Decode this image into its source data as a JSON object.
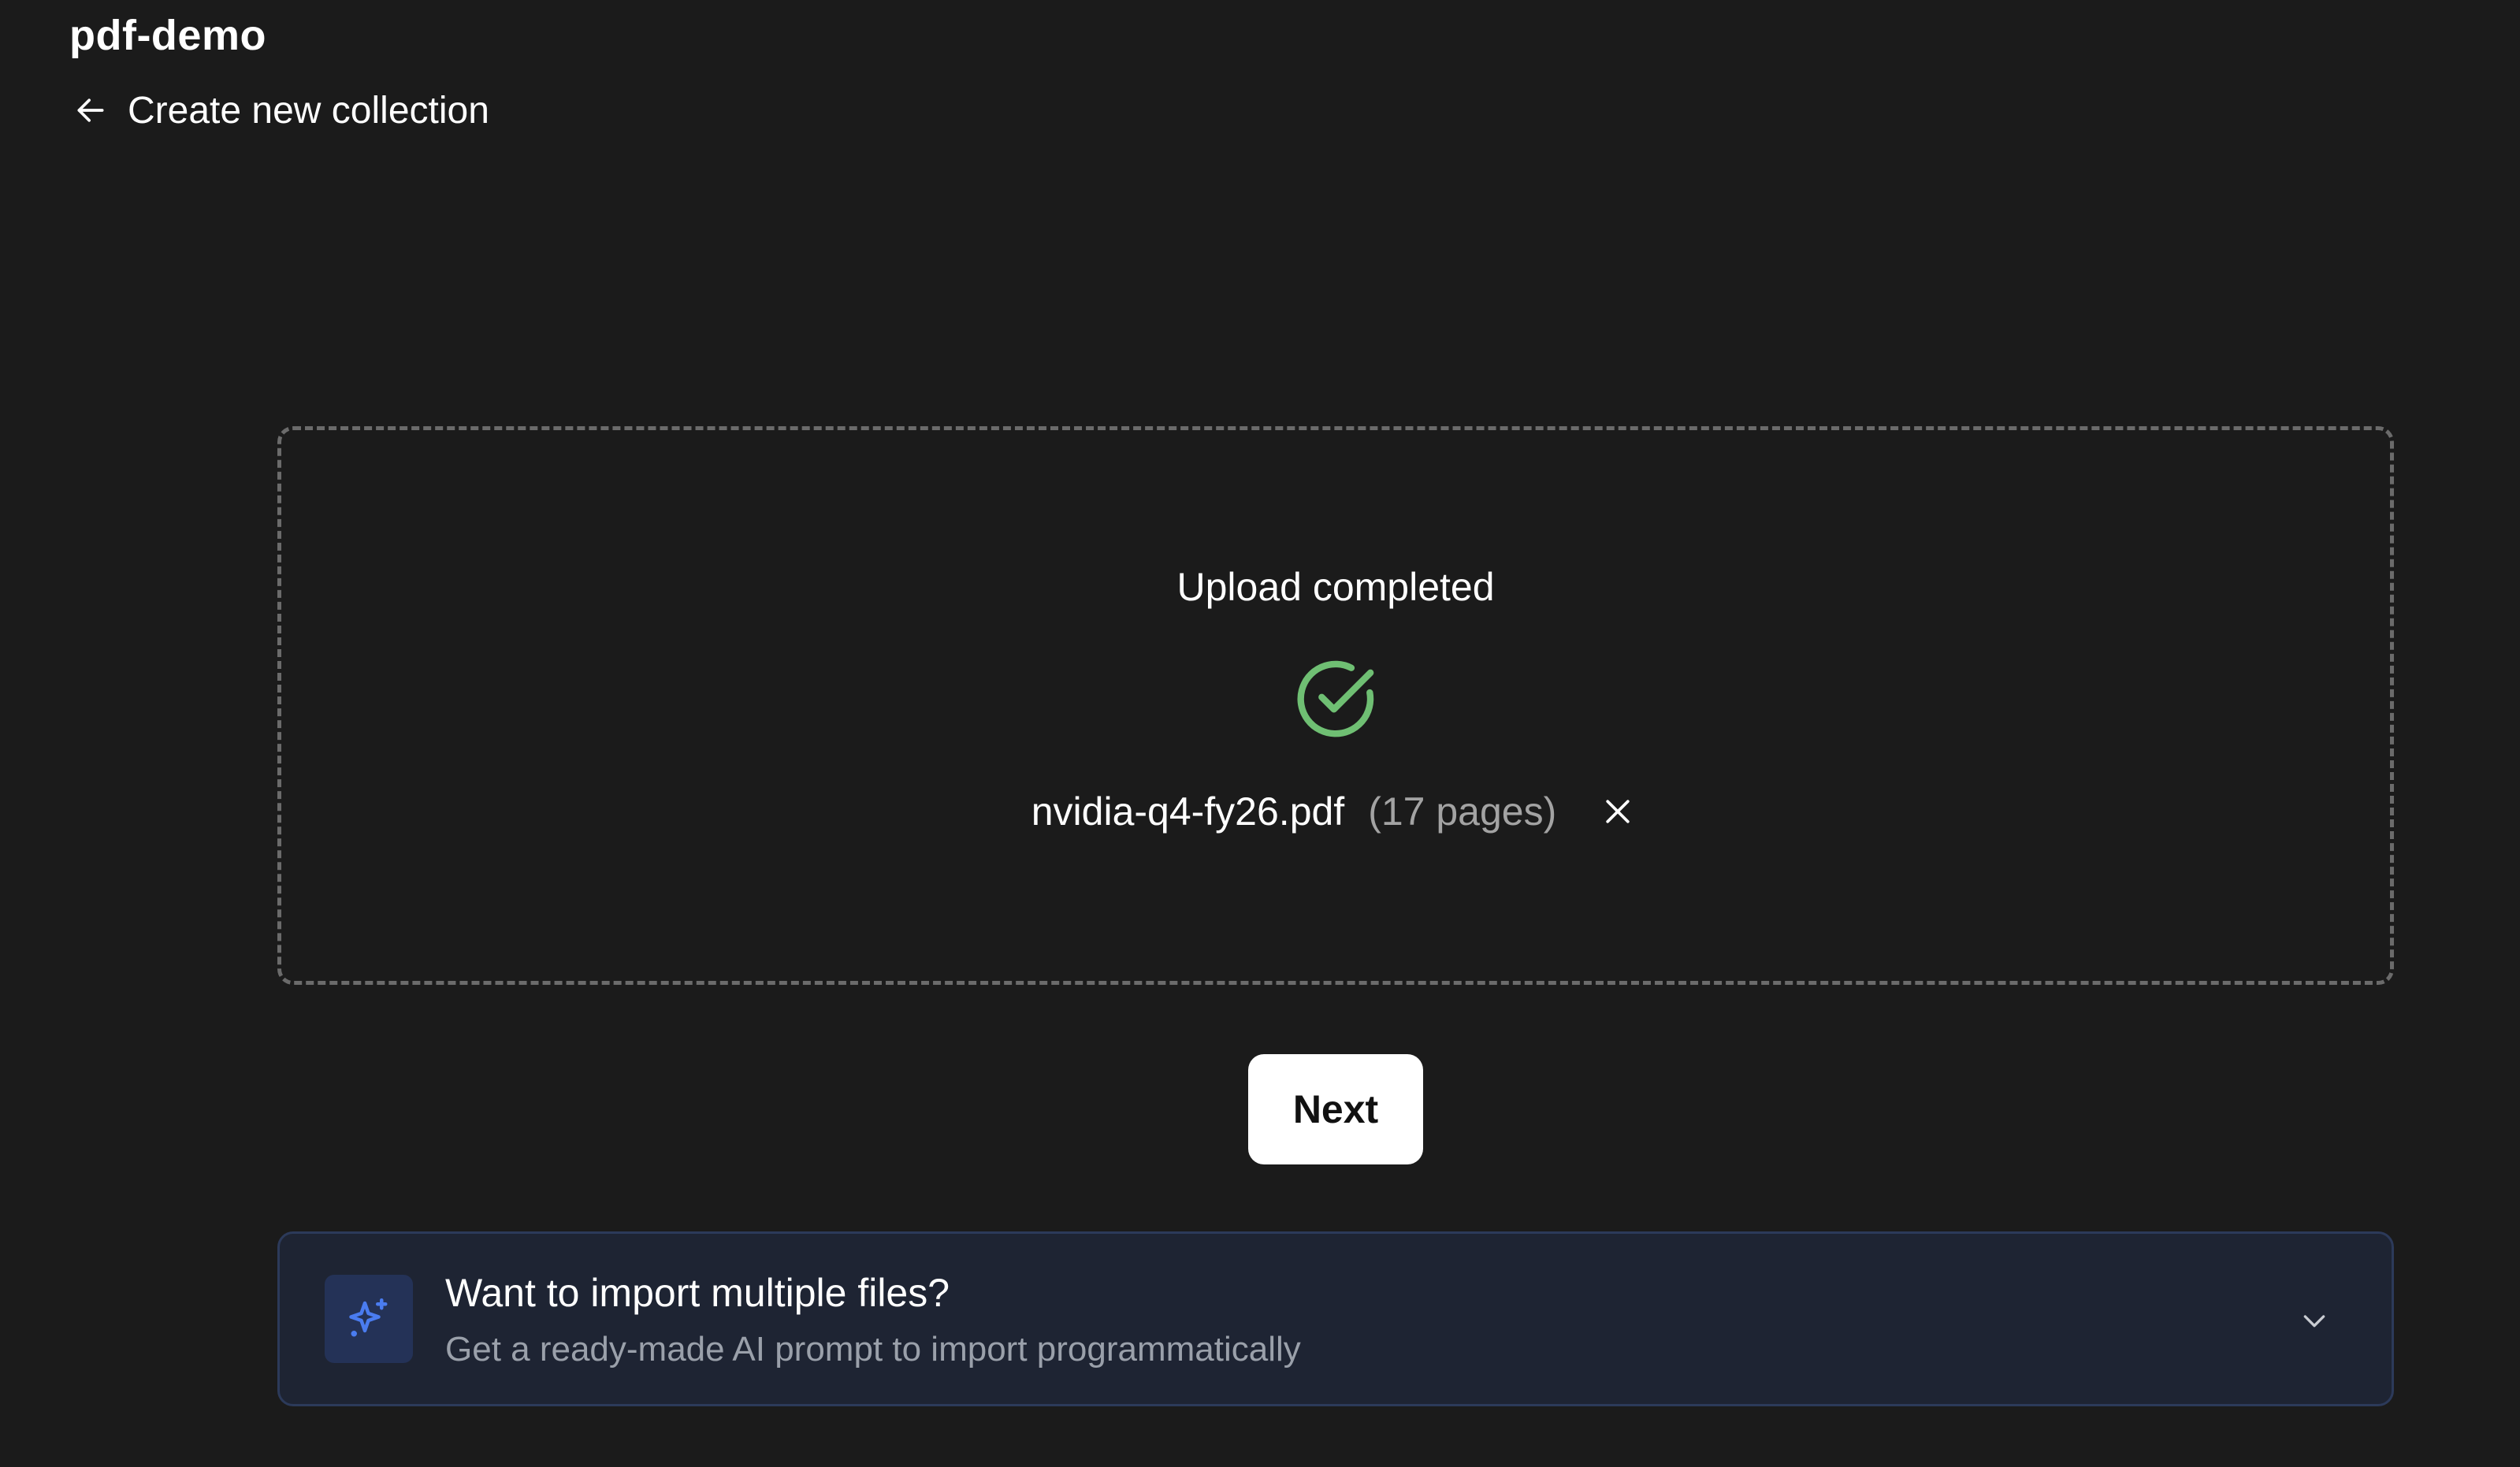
{
  "header": {
    "project_name": "pdf-demo",
    "page_title": "Create new collection"
  },
  "upload": {
    "status": "Upload completed",
    "file_name": "nvidia-q4-fy26.pdf",
    "page_count": "(17 pages)"
  },
  "actions": {
    "next_label": "Next"
  },
  "import_hint": {
    "title": "Want to import multiple files?",
    "subtitle": "Get a ready-made AI prompt to import programmatically"
  },
  "icons": {
    "back": "arrow-left-icon",
    "status": "check-circle-icon",
    "remove": "close-icon",
    "sparkle": "sparkles-icon",
    "expand": "chevron-down-icon"
  },
  "colors": {
    "background": "#1b1b1b",
    "success": "#6fbf73",
    "accent": "#4a7cf0",
    "card_background": "#1e2433"
  }
}
